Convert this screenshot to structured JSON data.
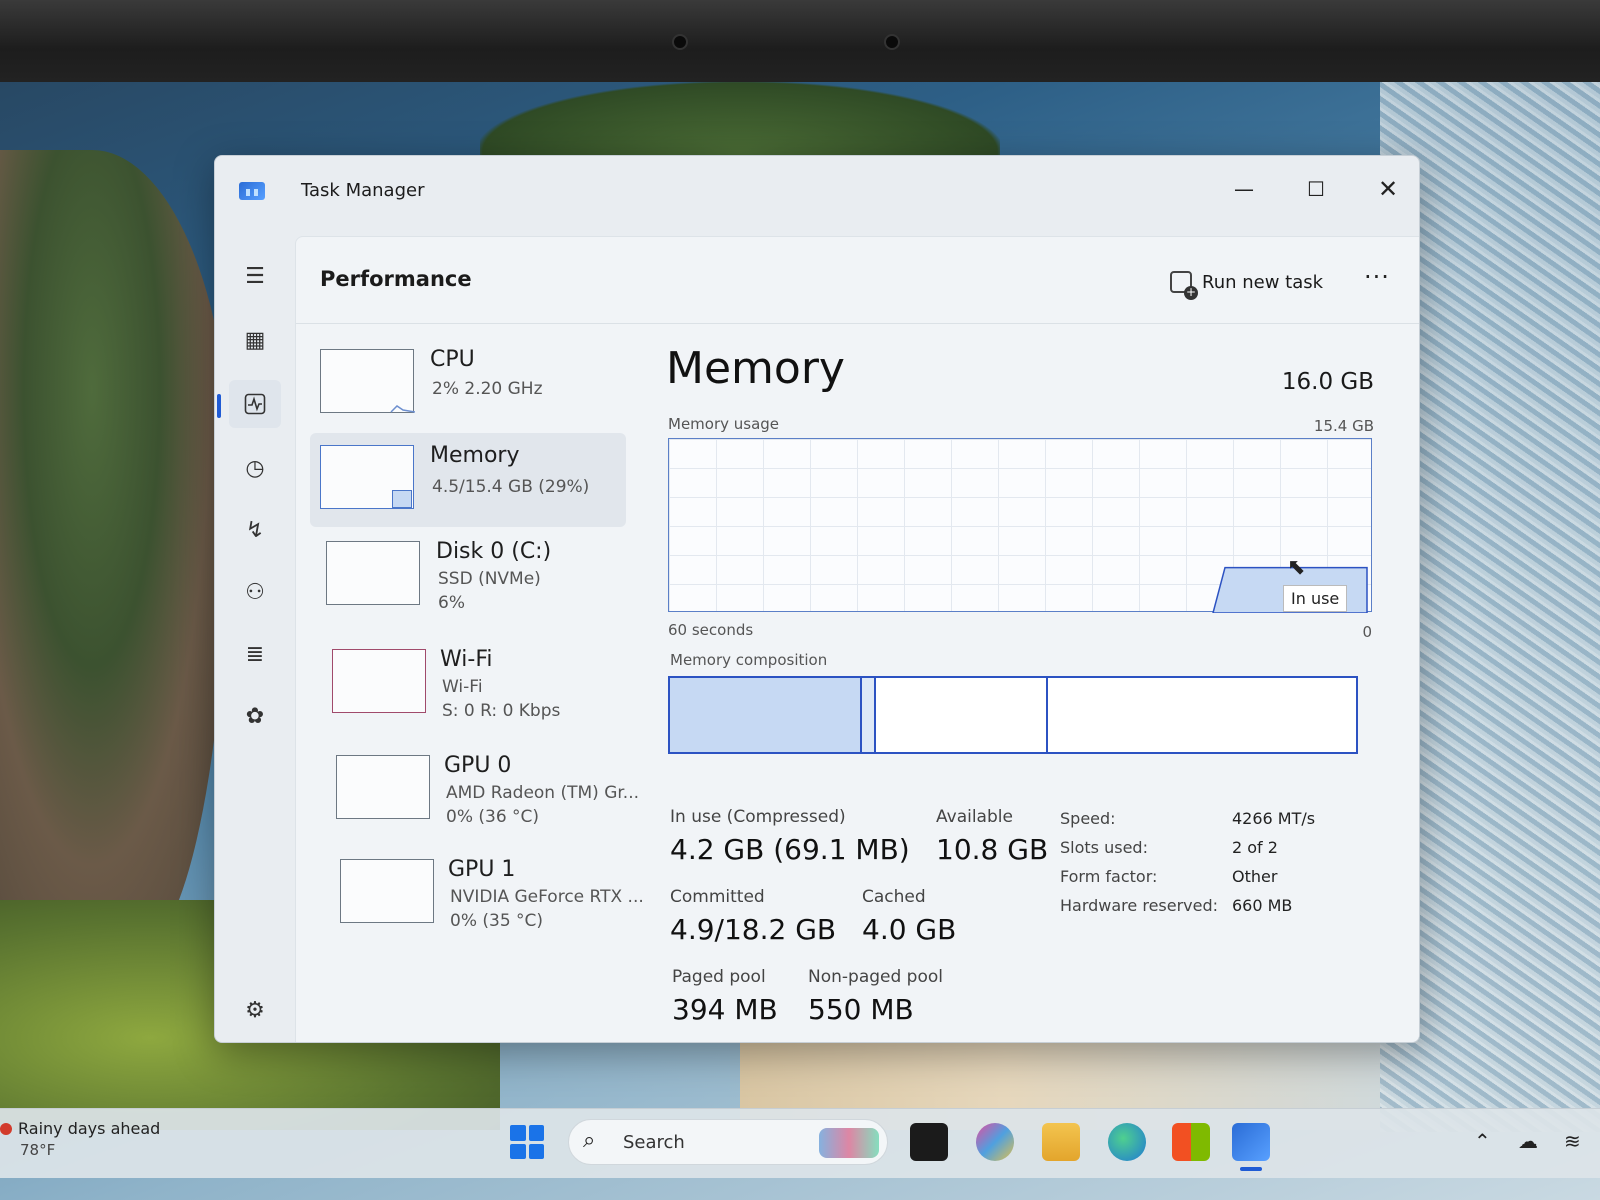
{
  "window": {
    "title": "Task Manager"
  },
  "header": {
    "page_title": "Performance",
    "run_new_task": "Run new task",
    "more_label": "···"
  },
  "resources": [
    {
      "name": "CPU",
      "line1": "2%  2.20 GHz",
      "line2": ""
    },
    {
      "name": "Memory",
      "line1": "4.5/15.4 GB (29%)",
      "line2": ""
    },
    {
      "name": "Disk 0 (C:)",
      "line1": "SSD (NVMe)",
      "line2": "6%"
    },
    {
      "name": "Wi-Fi",
      "line1": "Wi-Fi",
      "line2": "S: 0  R: 0 Kbps"
    },
    {
      "name": "GPU 0",
      "line1": "AMD Radeon (TM) Gr...",
      "line2": "0%  (36 °C)"
    },
    {
      "name": "GPU 1",
      "line1": "NVIDIA GeForce RTX ...",
      "line2": "0%  (35 °C)"
    }
  ],
  "detail": {
    "title": "Memory",
    "total": "16.0 GB",
    "usage_label": "Memory usage",
    "usage_max": "15.4 GB",
    "time_label": "60 seconds",
    "zero_label": "0",
    "tooltip": "In use",
    "composition_label": "Memory composition",
    "composition": {
      "in_use_fraction": 0.28,
      "modified_fraction": 0.02,
      "standby_fraction": 0.25
    },
    "usage_fraction": 0.29,
    "stats": {
      "in_use_label": "In use (Compressed)",
      "in_use_value": "4.2 GB (69.1 MB)",
      "available_label": "Available",
      "available_value": "10.8 GB",
      "committed_label": "Committed",
      "committed_value": "4.9/18.2 GB",
      "cached_label": "Cached",
      "cached_value": "4.0 GB",
      "paged_label": "Paged pool",
      "paged_value": "394 MB",
      "nonpaged_label": "Non-paged pool",
      "nonpaged_value": "550 MB"
    },
    "specs": [
      {
        "label": "Speed:",
        "value": "4266 MT/s"
      },
      {
        "label": "Slots used:",
        "value": "2 of 2"
      },
      {
        "label": "Form factor:",
        "value": "Other"
      },
      {
        "label": "Hardware reserved:",
        "value": "660 MB"
      }
    ]
  },
  "taskbar": {
    "weather_title": "Rainy days ahead",
    "weather_temp": "78°F",
    "search_placeholder": "Search"
  },
  "colors": {
    "accent": "#1f5bd4",
    "memory_line": "#2c52c2",
    "memory_fill": "#c6d9f3"
  }
}
